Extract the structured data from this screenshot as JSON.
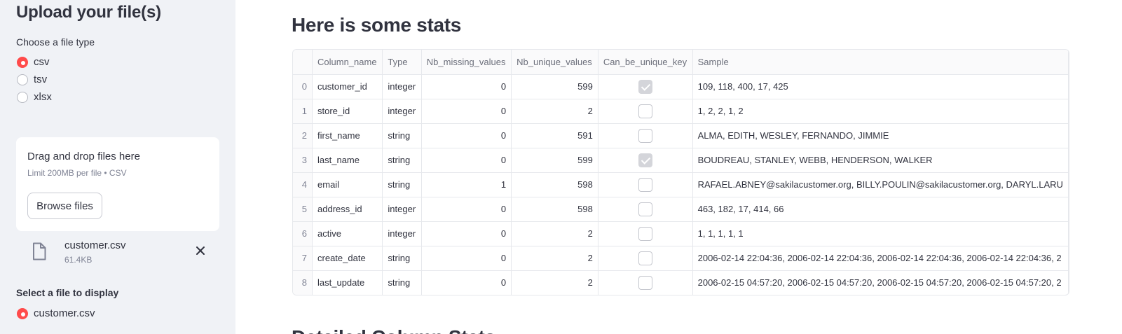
{
  "sidebar": {
    "title": "Upload your file(s)",
    "file_type_label": "Choose a file type",
    "file_types": [
      {
        "label": "csv",
        "selected": true
      },
      {
        "label": "tsv",
        "selected": false
      },
      {
        "label": "xlsx",
        "selected": false
      }
    ],
    "uploader": {
      "title": "Drag and drop files here",
      "limit": "Limit 200MB per file • CSV",
      "browse_label": "Browse files"
    },
    "uploaded_file": {
      "name": "customer.csv",
      "size": "61.4KB",
      "icon": "file-icon",
      "remove_icon": "close-icon"
    },
    "display_label": "Select a file to display",
    "display_files": [
      {
        "label": "customer.csv",
        "selected": true
      }
    ]
  },
  "main": {
    "heading": "Here is some stats",
    "table": {
      "columns": [
        "",
        "Column_name",
        "Type",
        "Nb_missing_values",
        "Nb_unique_values",
        "Can_be_unique_key",
        "Sample"
      ],
      "rows": [
        {
          "index": "0",
          "name": "customer_id",
          "type": "integer",
          "missing": "0",
          "unique": "599",
          "key": true,
          "sample": "109, 118, 400, 17, 425"
        },
        {
          "index": "1",
          "name": "store_id",
          "type": "integer",
          "missing": "0",
          "unique": "2",
          "key": false,
          "sample": "1, 2, 2, 1, 2"
        },
        {
          "index": "2",
          "name": "first_name",
          "type": "string",
          "missing": "0",
          "unique": "591",
          "key": false,
          "sample": "ALMA, EDITH, WESLEY, FERNANDO, JIMMIE"
        },
        {
          "index": "3",
          "name": "last_name",
          "type": "string",
          "missing": "0",
          "unique": "599",
          "key": true,
          "sample": "BOUDREAU, STANLEY, WEBB, HENDERSON, WALKER"
        },
        {
          "index": "4",
          "name": "email",
          "type": "string",
          "missing": "1",
          "unique": "598",
          "key": false,
          "sample": "RAFAEL.ABNEY@sakilacustomer.org, BILLY.POULIN@sakilacustomer.org, DARYL.LARU"
        },
        {
          "index": "5",
          "name": "address_id",
          "type": "integer",
          "missing": "0",
          "unique": "598",
          "key": false,
          "sample": "463, 182, 17, 414, 66"
        },
        {
          "index": "6",
          "name": "active",
          "type": "integer",
          "missing": "0",
          "unique": "2",
          "key": false,
          "sample": "1, 1, 1, 1, 1"
        },
        {
          "index": "7",
          "name": "create_date",
          "type": "string",
          "missing": "0",
          "unique": "2",
          "key": false,
          "sample": "2006-02-14 22:04:36, 2006-02-14 22:04:36, 2006-02-14 22:04:36, 2006-02-14 22:04:36, 2"
        },
        {
          "index": "8",
          "name": "last_update",
          "type": "string",
          "missing": "0",
          "unique": "2",
          "key": false,
          "sample": "2006-02-15 04:57:20, 2006-02-15 04:57:20, 2006-02-15 04:57:20, 2006-02-15 04:57:20, 2"
        }
      ]
    },
    "next_heading": "Detailed Column Stats"
  }
}
